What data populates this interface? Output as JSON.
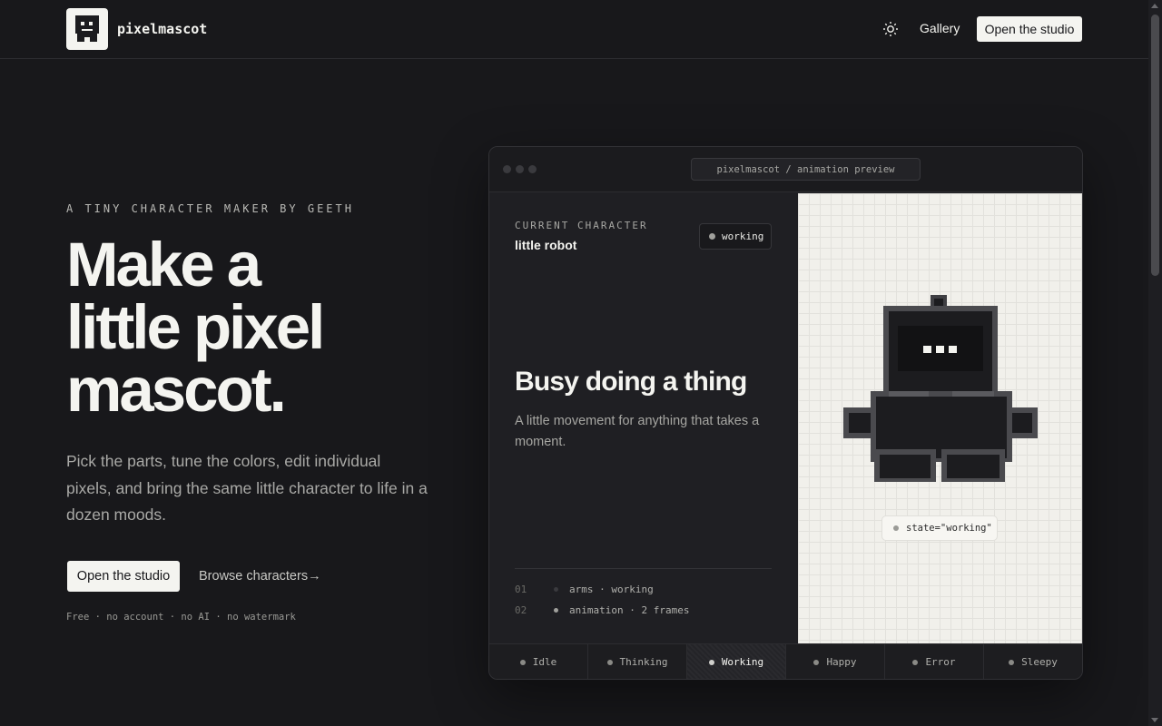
{
  "header": {
    "brand": "pixelmascot",
    "gallery_label": "Gallery",
    "cta_label": "Open the studio"
  },
  "hero": {
    "eyebrow": "A TINY CHARACTER MAKER BY GEETH",
    "headline_lines": [
      "Make a",
      "little pixel",
      "mascot."
    ],
    "subcopy": "Pick the parts, tune the colors, edit individual pixels, and bring the same little character to life in a dozen moods.",
    "primary_cta": "Open the studio",
    "secondary_cta": "Browse characters",
    "secondary_arrow": "→",
    "fineprint": "Free · no account · no AI · no watermark"
  },
  "preview": {
    "url": "pixelmascot / animation preview",
    "current_label": "CURRENT CHARACTER",
    "character_name": "little robot",
    "state_pill": "working",
    "title": "Busy doing a thing",
    "description": "A little movement for anything that takes a moment.",
    "rows": [
      {
        "num": "01",
        "text": "arms · working",
        "dot": "#3a3a3e"
      },
      {
        "num": "02",
        "text": "animation · 2 frames",
        "dot": "#a0a09c"
      }
    ],
    "state_tag": "state=\"working\"",
    "tabs": [
      {
        "label": "Idle",
        "active": false
      },
      {
        "label": "Thinking",
        "active": false
      },
      {
        "label": "Working",
        "active": true
      },
      {
        "label": "Happy",
        "active": false
      },
      {
        "label": "Error",
        "active": false
      },
      {
        "label": "Sleepy",
        "active": false
      }
    ]
  },
  "colors": {
    "background": "#18181b",
    "light": "#f4f4f0",
    "canvas": "#f1f0eb",
    "robot_dark": "#1c1c1f"
  },
  "icons": {
    "theme_toggle": "sun-icon",
    "logo": "robot-logo-icon"
  }
}
